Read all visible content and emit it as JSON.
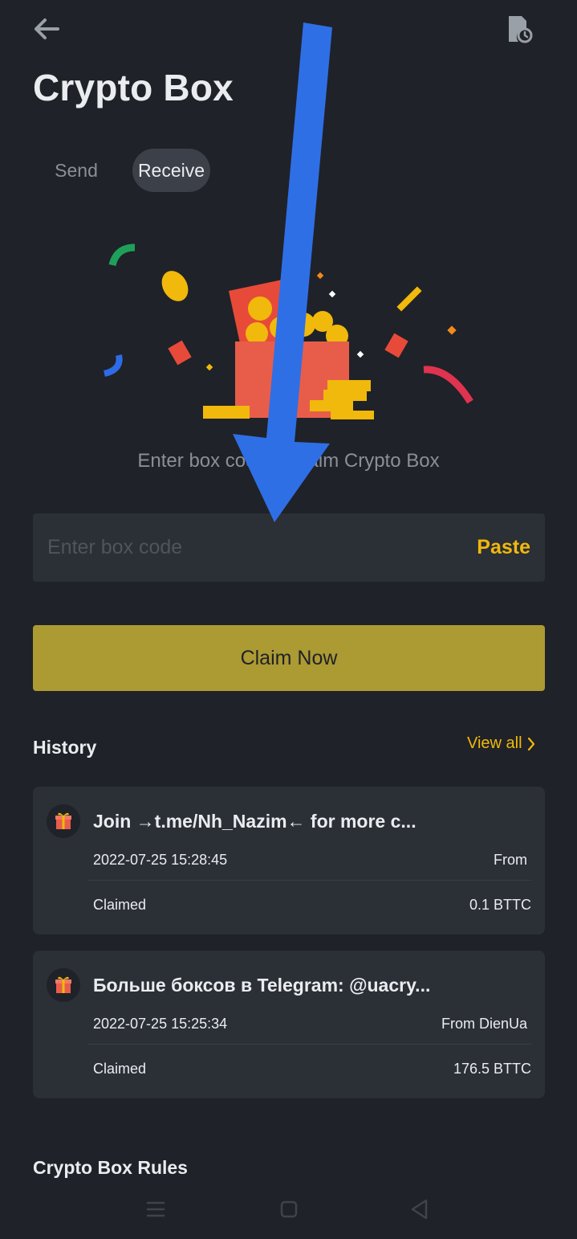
{
  "header": {
    "back_icon": "arrow-left-icon",
    "history_icon": "document-clock-icon",
    "title": "Crypto Box"
  },
  "tabs": [
    {
      "label": "Send",
      "active": false
    },
    {
      "label": "Receive",
      "active": true
    }
  ],
  "main": {
    "illustration": "gift-box-with-coins-illustration",
    "instruction": "Enter box code to claim Crypto Box",
    "code_input": {
      "value": "",
      "placeholder": "Enter box code"
    },
    "paste_label": "Paste",
    "claim_label": "Claim Now"
  },
  "history": {
    "title": "History",
    "view_all_label": "View all",
    "items": [
      {
        "title": "Join →t.me/Nh_Nazim← for more c...",
        "date": "2022-07-25 15:28:45",
        "from": "From",
        "status": "Claimed",
        "amount": "0.1 BTTC"
      },
      {
        "title": "Больше боксов в Telegram: @uacry...",
        "date": "2022-07-25 15:25:34",
        "from": "From DienUa",
        "status": "Claimed",
        "amount": "176.5 BTTC"
      }
    ]
  },
  "rules": {
    "title": "Crypto Box Rules"
  },
  "system_nav": {
    "menu_icon": "menu-icon",
    "home_icon": "home-square-icon",
    "back_icon": "back-triangle-icon"
  },
  "colors": {
    "background": "#1f2228",
    "surface": "#2b2f36",
    "accent": "#f0b90b",
    "claim_button": "#ac9a33",
    "annotation_arrow": "#2f6fe6"
  }
}
